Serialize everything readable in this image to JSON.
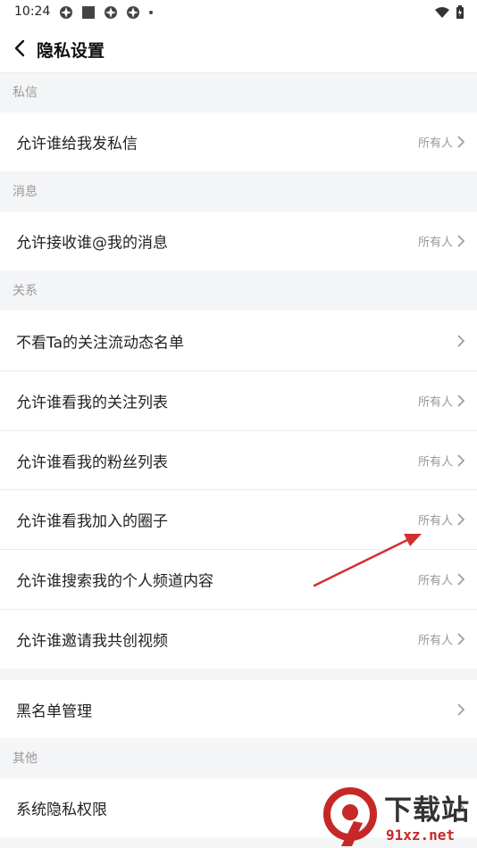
{
  "status_bar": {
    "time": "10:24"
  },
  "header": {
    "title": "隐私设置"
  },
  "sections": {
    "private_message": {
      "title": "私信",
      "items": [
        {
          "label": "允许谁给我发私信",
          "value": "所有人"
        }
      ]
    },
    "messages": {
      "title": "消息",
      "items": [
        {
          "label": "允许接收谁@我的消息",
          "value": "所有人"
        }
      ]
    },
    "relations": {
      "title": "关系",
      "items": [
        {
          "label": "不看Ta的关注流动态名单",
          "value": ""
        },
        {
          "label": "允许谁看我的关注列表",
          "value": "所有人"
        },
        {
          "label": "允许谁看我的粉丝列表",
          "value": "所有人"
        },
        {
          "label": "允许谁看我加入的圈子",
          "value": "所有人"
        },
        {
          "label": "允许谁搜索我的个人频道内容",
          "value": "所有人"
        },
        {
          "label": "允许谁邀请我共创视频",
          "value": "所有人"
        }
      ]
    },
    "blacklist": {
      "items": [
        {
          "label": "黑名单管理",
          "value": ""
        }
      ]
    },
    "other": {
      "title": "其他",
      "items": [
        {
          "label": "系统隐私权限",
          "value": ""
        }
      ]
    }
  },
  "watermark": {
    "main": "下载站",
    "sub": "91xz.net",
    "logo_glyph": "9"
  },
  "colors": {
    "annotation_arrow": "#d32f2f",
    "secondary_text": "#999999",
    "background": "#f4f5f7"
  }
}
